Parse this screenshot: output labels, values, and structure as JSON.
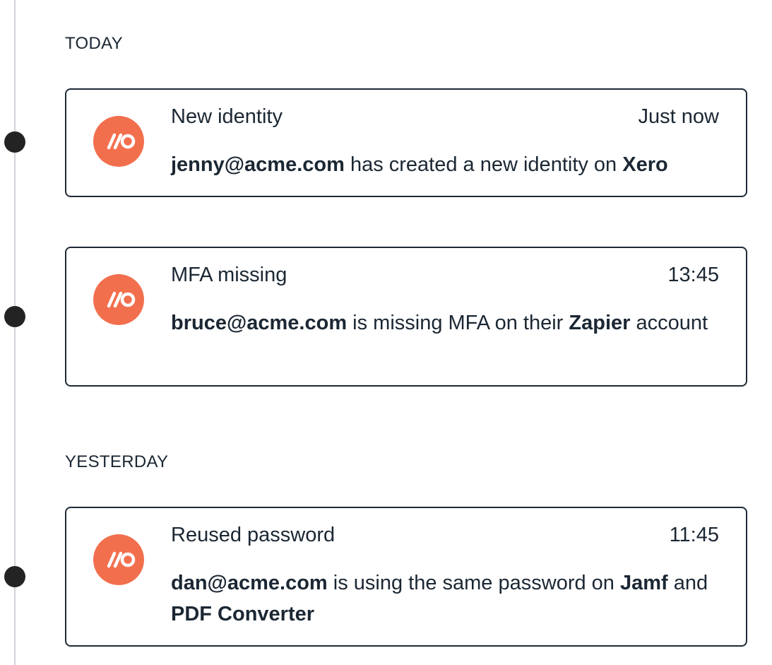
{
  "sections": [
    {
      "label": "TODAY",
      "cards": [
        {
          "title": "New identity",
          "time": "Just now",
          "email": "jenny@acme.com",
          "text1": " has created a new identity on ",
          "app1": "Xero"
        },
        {
          "title": "MFA missing",
          "time": "13:45",
          "email": "bruce@acme.com",
          "text1": " is missing MFA on their ",
          "app1": "Zapier",
          "text2": " account"
        }
      ]
    },
    {
      "label": "YESTERDAY",
      "cards": [
        {
          "title": "Reused password",
          "time": "11:45",
          "email": "dan@acme.com",
          "text1": " is using the same password on ",
          "app1": "Jamf",
          "text2": " and ",
          "app2": "PDF Converter"
        }
      ]
    }
  ],
  "logo_icon": "brand-logo-icon",
  "colors": {
    "logo_background": "#f26f4e",
    "card_border": "#1e2a36",
    "timeline_dot": "#232323",
    "timeline_line": "#cfd3d7"
  }
}
